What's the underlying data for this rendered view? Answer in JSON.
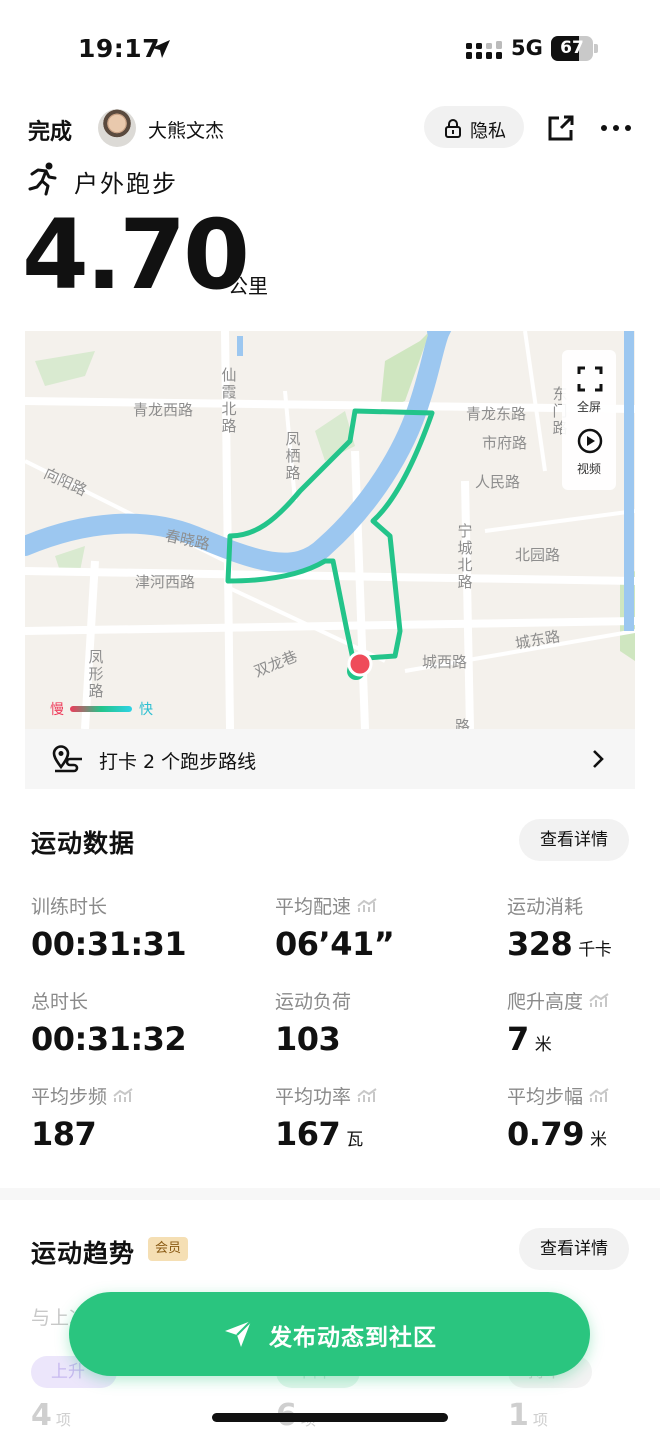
{
  "status_bar": {
    "time": "19:17",
    "network": "5G",
    "battery": "67",
    "battery_level": 0.67
  },
  "header": {
    "done_label": "完成",
    "user_name": "大熊文杰",
    "privacy_label": "隐私"
  },
  "activity": {
    "sport_type": "户外跑步",
    "distance": "4.70",
    "distance_unit": "公里"
  },
  "map": {
    "labels": {
      "qinglong_west": "青龙西路",
      "xianxia_north": "仙霞北路",
      "fengqi": "凤栖路",
      "qinglong_east": "青龙东路",
      "dongcheng": "东门路",
      "shifu": "市府路",
      "renmin": "人民路",
      "xiangyang": "向阳路",
      "chunxiao": "春晓路",
      "jinhe_west": "津河西路",
      "ningcheng_north": "宁城北路",
      "beiyuan": "北园路",
      "chengdong": "城东路",
      "chengxi": "城西路",
      "shuanglong": "双龙巷",
      "fengxing": "凤形路",
      "bottom_road": "路"
    },
    "controls": {
      "fullscreen": "全屏",
      "video": "视频"
    },
    "legend": {
      "slow": "慢",
      "fast": "快"
    },
    "checkin_text": "打卡 2 个跑步路线"
  },
  "stats": {
    "title": "运动数据",
    "detail_label": "查看详情",
    "items": [
      {
        "label": "训练时长",
        "value": "00:31:31",
        "unit": "",
        "trend": false
      },
      {
        "label": "平均配速",
        "value": "06’41”",
        "unit": "",
        "trend": true
      },
      {
        "label": "运动消耗",
        "value": "328",
        "unit": "千卡",
        "trend": false
      },
      {
        "label": "总时长",
        "value": "00:31:32",
        "unit": "",
        "trend": false
      },
      {
        "label": "运动负荷",
        "value": "103",
        "unit": "",
        "trend": false
      },
      {
        "label": "爬升高度",
        "value": "7",
        "unit": "米",
        "trend": true
      },
      {
        "label": "平均步频",
        "value": "187",
        "unit": "",
        "trend": true
      },
      {
        "label": "平均功率",
        "value": "167",
        "unit": "瓦",
        "trend": true
      },
      {
        "label": "平均步幅",
        "value": "0.79",
        "unit": "米",
        "trend": true
      }
    ]
  },
  "trends": {
    "title": "运动趋势",
    "member_badge": "会员",
    "detail_label": "查看详情",
    "compare_label": "与上次",
    "chips": [
      "上升",
      "下降",
      "持平"
    ],
    "counts": [
      {
        "value": "4",
        "unit": "项"
      },
      {
        "value": "6",
        "unit": "项"
      },
      {
        "value": "1",
        "unit": "项"
      }
    ]
  },
  "publish_label": "发布动态到社区",
  "colors": {
    "accent_green": "#2ac57f",
    "route_green": "#23c48a",
    "river_blue": "#9cc7f0",
    "marker_red": "#ef4b5a"
  }
}
